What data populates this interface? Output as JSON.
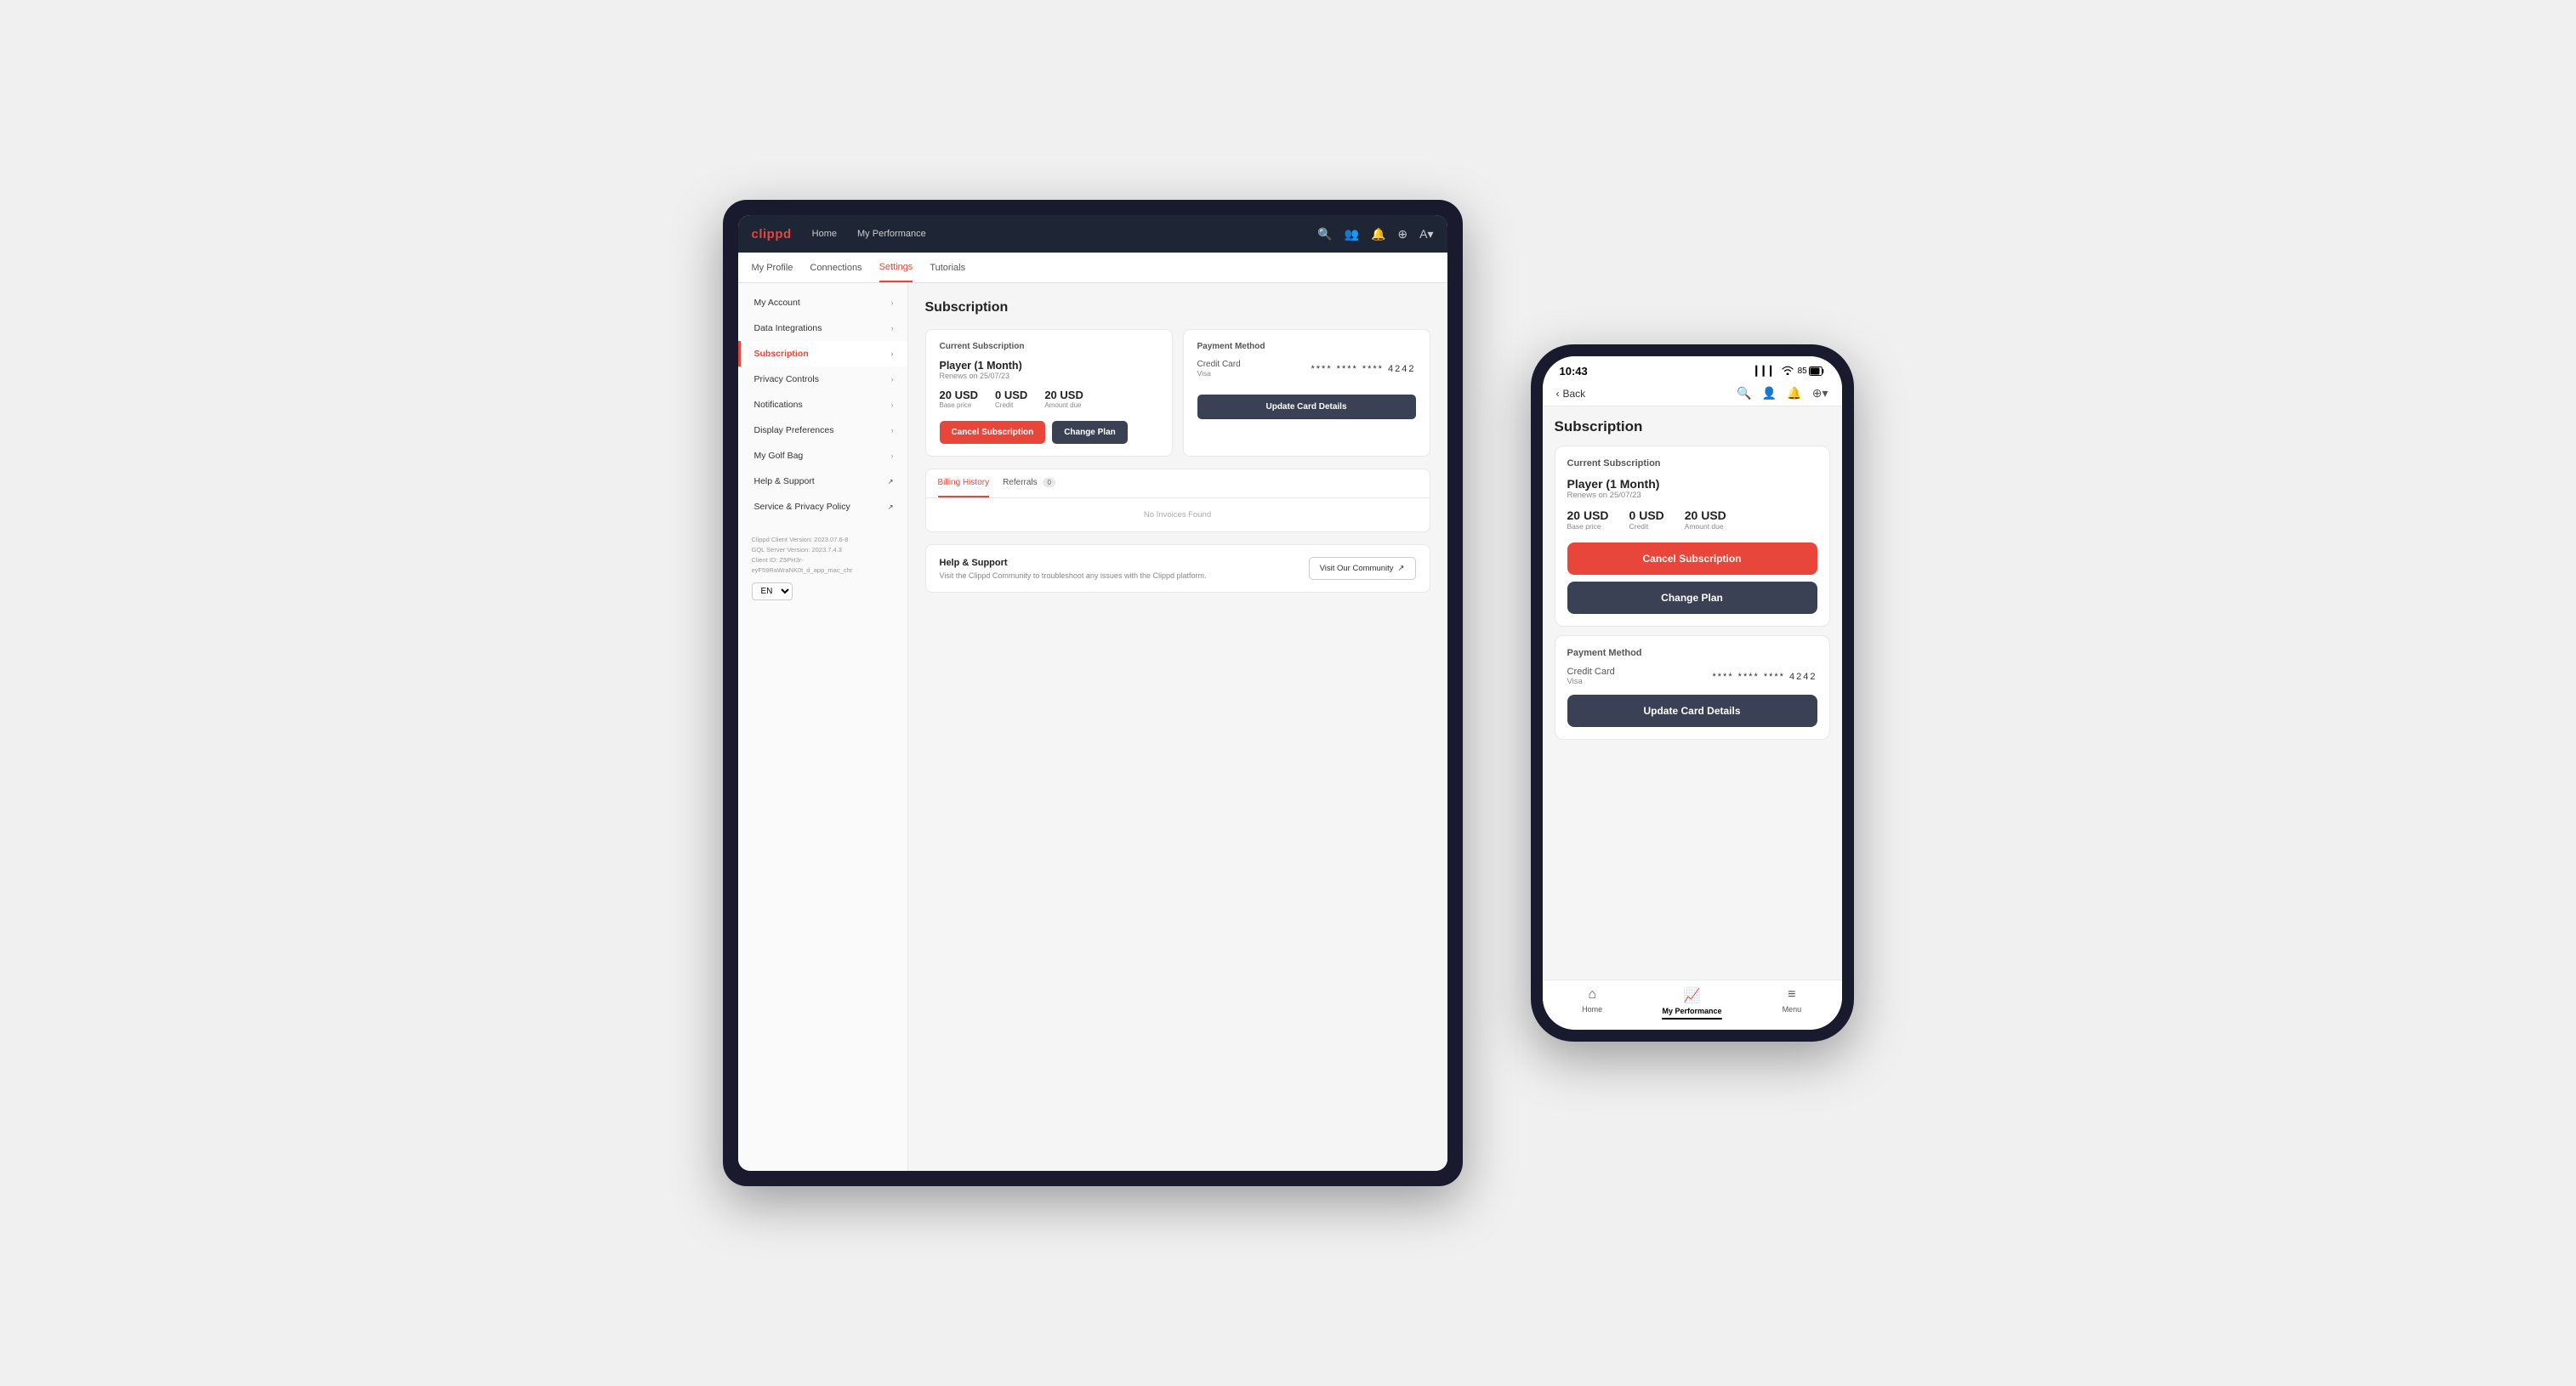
{
  "tablet": {
    "nav": {
      "logo": "clippd",
      "links": [
        "Home",
        "My Performance"
      ],
      "icons": [
        "🔍",
        "👥",
        "🔔",
        "⊕",
        "A"
      ]
    },
    "subnav": {
      "items": [
        "My Profile",
        "Connections",
        "Settings",
        "Tutorials"
      ],
      "active": "Settings"
    },
    "sidebar": {
      "items": [
        {
          "label": "My Account",
          "active": false
        },
        {
          "label": "Data Integrations",
          "active": false
        },
        {
          "label": "Subscription",
          "active": true
        },
        {
          "label": "Privacy Controls",
          "active": false
        },
        {
          "label": "Notifications",
          "active": false
        },
        {
          "label": "Display Preferences",
          "active": false
        },
        {
          "label": "My Golf Bag",
          "active": false
        },
        {
          "label": "Help & Support",
          "active": false,
          "external": true
        },
        {
          "label": "Service & Privacy Policy",
          "active": false,
          "external": true
        }
      ],
      "footer": {
        "line1": "Clippd Client Version: 2023.07.6-8",
        "line2": "GQL Server Version: 2023.7.4.3",
        "line3": "Client ID: Z5PH3r-eyF59RaWraNK0t_d_app_mac_chr"
      },
      "lang": "EN"
    },
    "main": {
      "page_title": "Subscription",
      "current_sub": {
        "section_title": "Current Subscription",
        "plan_name": "Player (1 Month)",
        "renew_date": "Renews on 25/07/23",
        "base_price_value": "20 USD",
        "base_price_label": "Base price",
        "credit_value": "0 USD",
        "credit_label": "Credit",
        "amount_due_value": "20 USD",
        "amount_due_label": "Amount due",
        "cancel_btn": "Cancel Subscription",
        "change_plan_btn": "Change Plan"
      },
      "payment_method": {
        "section_title": "Payment Method",
        "card_type": "Credit Card",
        "card_brand": "Visa",
        "card_masked": "**** **** **** 4242",
        "update_btn": "Update Card Details"
      },
      "billing": {
        "tab_billing": "Billing History",
        "tab_referrals": "Referrals",
        "referrals_count": "0",
        "empty_message": "No Invoices Found"
      },
      "help": {
        "title": "Help & Support",
        "description": "Visit the Clippd Community to troubleshoot any issues with the Clippd platform.",
        "visit_btn": "Visit Our Community",
        "external_icon": "↗"
      }
    }
  },
  "phone": {
    "status_bar": {
      "time": "10:43",
      "signal": "▎▎▎",
      "wifi": "WiFi",
      "battery": "85"
    },
    "top_nav": {
      "back_label": "Back",
      "icons": [
        "🔍",
        "👤",
        "🔔",
        "⊕"
      ]
    },
    "content": {
      "page_title": "Subscription",
      "current_sub": {
        "section_title": "Current Subscription",
        "plan_name": "Player (1 Month)",
        "renew_date": "Renews on 25/07/23",
        "base_price_value": "20 USD",
        "base_price_label": "Base price",
        "credit_value": "0 USD",
        "credit_label": "Credit",
        "amount_due_value": "20 USD",
        "amount_due_label": "Amount due",
        "cancel_btn": "Cancel Subscription",
        "change_plan_btn": "Change Plan"
      },
      "payment_method": {
        "section_title": "Payment Method",
        "card_type": "Credit Card",
        "card_brand": "Visa",
        "card_masked": "**** **** **** 4242",
        "update_btn": "Update Card Details"
      }
    },
    "bottom_nav": {
      "items": [
        "Home",
        "My Performance",
        "Menu"
      ],
      "active": "My Performance",
      "icons": [
        "⌂",
        "📈",
        "≡"
      ]
    }
  }
}
